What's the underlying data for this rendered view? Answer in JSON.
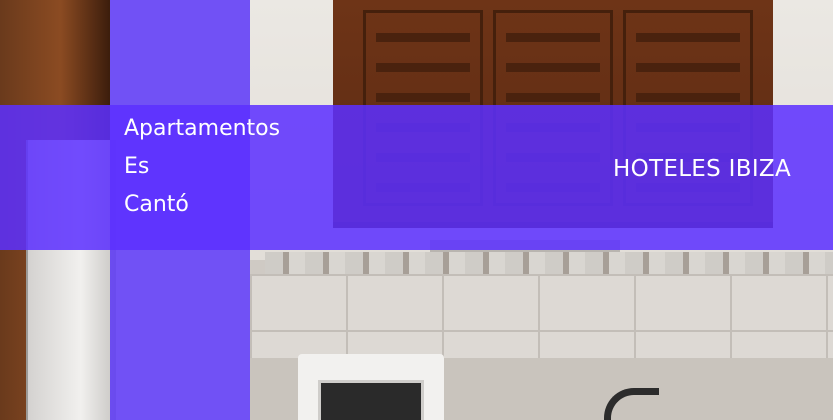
{
  "hotel": {
    "name_lines": [
      "Apartamentos",
      "Es",
      "Cantó"
    ]
  },
  "brand": {
    "label": "HOTELES IBIZA"
  },
  "colors": {
    "overlay_purple": "#5C30FF",
    "text": "#FFFFFF"
  }
}
